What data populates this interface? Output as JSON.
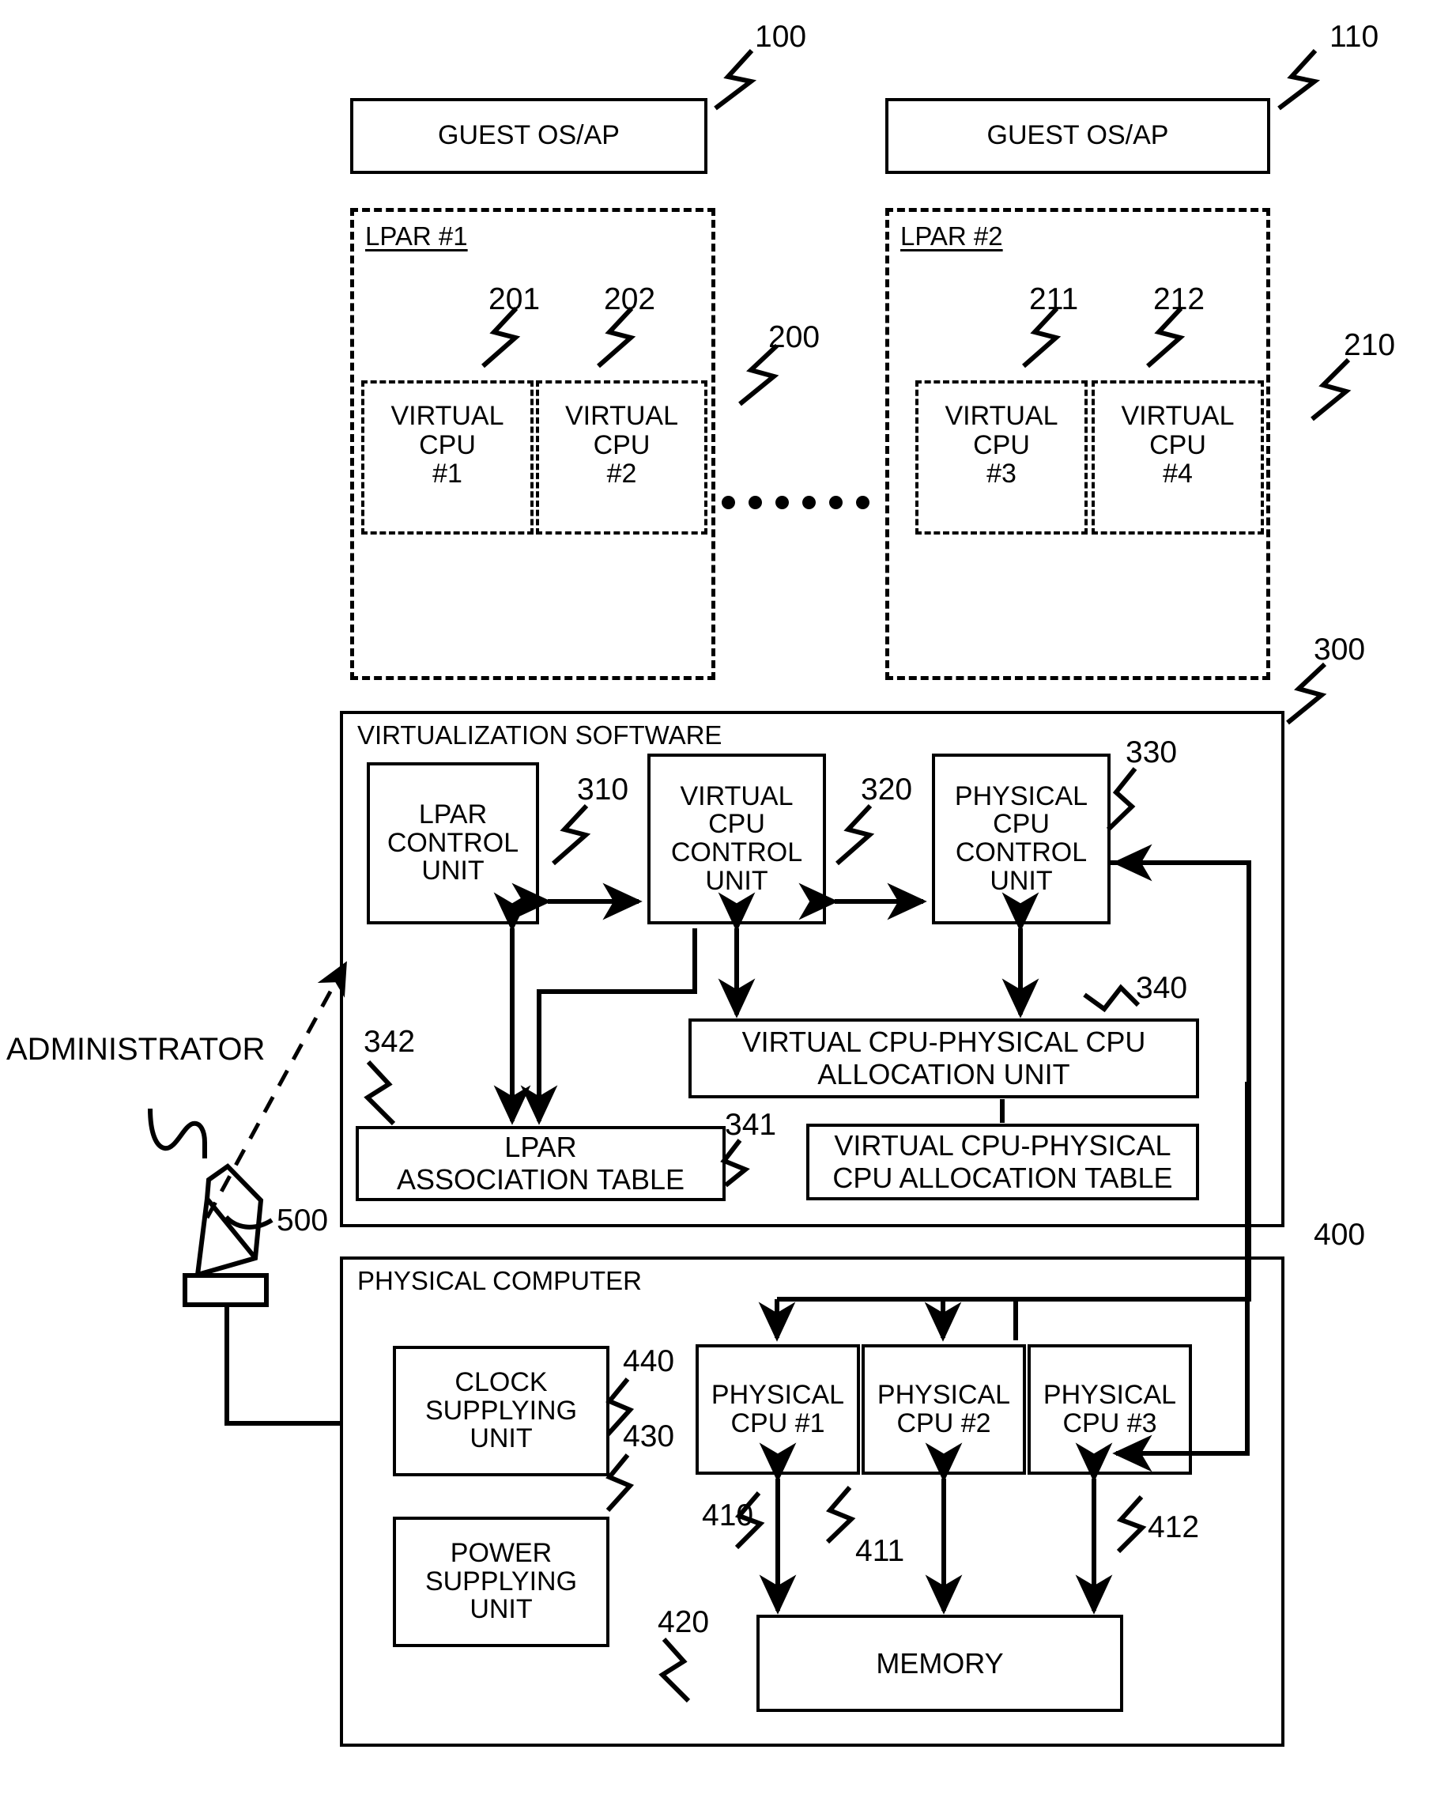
{
  "figure": {
    "kind": "patent-block-diagram",
    "administrator_label": "ADMINISTRATOR"
  },
  "guest_os": [
    {
      "label": "GUEST OS/AP",
      "ref": "100"
    },
    {
      "label": "GUEST OS/AP",
      "ref": "110"
    }
  ],
  "lpars": [
    {
      "title": "LPAR #1",
      "ref": "200",
      "vcpus": [
        {
          "label": "VIRTUAL\nCPU\n#1",
          "ref": "201"
        },
        {
          "label": "VIRTUAL\nCPU\n#2",
          "ref": "202"
        }
      ]
    },
    {
      "title": "LPAR #2",
      "ref": "210",
      "vcpus": [
        {
          "label": "VIRTUAL\nCPU\n#3",
          "ref": "211"
        },
        {
          "label": "VIRTUAL\nCPU\n#4",
          "ref": "212"
        }
      ]
    }
  ],
  "virtualization_software": {
    "title": "VIRTUALIZATION SOFTWARE",
    "ref": "300",
    "units": [
      {
        "label": "LPAR\nCONTROL\nUNIT",
        "ref": "310"
      },
      {
        "label": "VIRTUAL\nCPU\nCONTROL\nUNIT",
        "ref": "320"
      },
      {
        "label": "PHYSICAL\nCPU\nCONTROL\nUNIT",
        "ref": "330"
      }
    ],
    "allocation_unit": {
      "label": "VIRTUAL CPU-PHYSICAL CPU\nALLOCATION UNIT",
      "ref": "340"
    },
    "allocation_table": {
      "label": "VIRTUAL CPU-PHYSICAL\nCPU ALLOCATION TABLE",
      "ref": "341"
    },
    "association_table": {
      "label": "LPAR\nASSOCIATION TABLE",
      "ref": "342"
    }
  },
  "physical_computer": {
    "title": "PHYSICAL COMPUTER",
    "ref": "400",
    "clock_unit": {
      "label": "CLOCK\nSUPPLYING\nUNIT",
      "ref": "440"
    },
    "power_unit": {
      "label": "POWER\nSUPPLYING\nUNIT",
      "ref": "430"
    },
    "cpus": [
      {
        "label": "PHYSICAL\nCPU #1",
        "ref": "410"
      },
      {
        "label": "PHYSICAL\nCPU #2",
        "ref": "411"
      },
      {
        "label": "PHYSICAL\nCPU #3",
        "ref": "412"
      }
    ],
    "memory": {
      "label": "MEMORY",
      "ref": "420"
    }
  },
  "console": {
    "ref": "500"
  }
}
